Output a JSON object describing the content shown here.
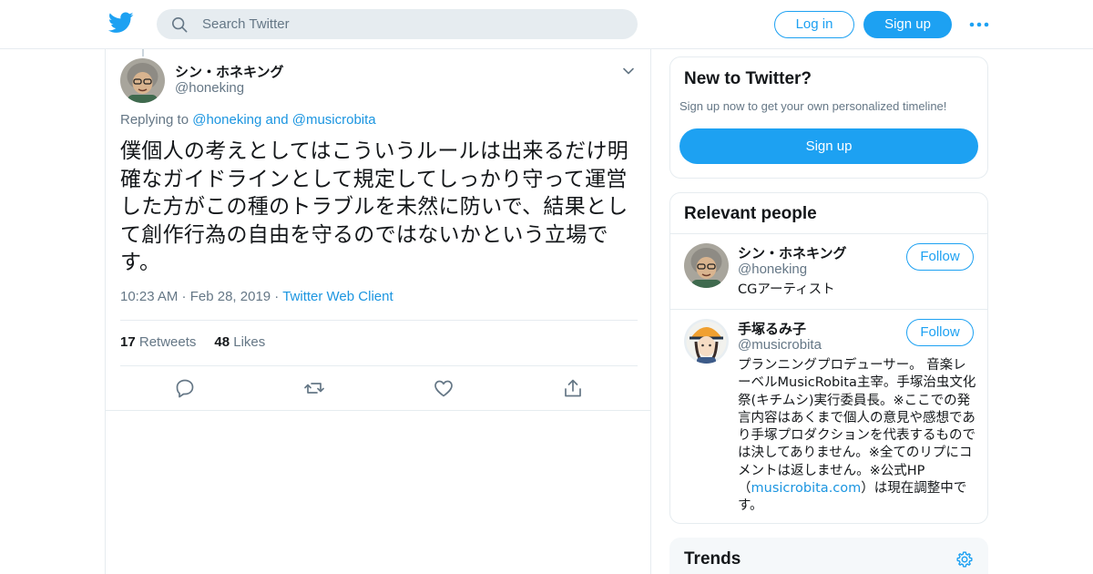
{
  "nav": {
    "search_placeholder": "Search Twitter",
    "login_label": "Log in",
    "signup_label": "Sign up",
    "logo_icon": "twitter-bird-icon",
    "more_icon": "more-dots-icon"
  },
  "tweet": {
    "author_name": "シン・ホネキング",
    "author_handle": "@honeking",
    "replying_prefix": "Replying to ",
    "replying_to_1": "@honeking",
    "replying_and": " and ",
    "replying_to_2": "@musicrobita",
    "text": "僕個人の考えとしてはこういうルールは出来るだけ明確なガイドラインとして規定してしっかり守って運営した方がこの種のトラブルを未然に防いで、結果として創作行為の自由を守るのではないかという立場です。",
    "time": "10:23 AM",
    "date": "Feb 28, 2019",
    "source": "Twitter Web Client",
    "retweets_count": "17",
    "retweets_label": "Retweets",
    "likes_count": "48",
    "likes_label": "Likes"
  },
  "sidebar": {
    "new_title": "New to Twitter?",
    "new_sub": "Sign up now to get your own personalized timeline!",
    "new_signup": "Sign up",
    "people_title": "Relevant people",
    "people": [
      {
        "name": "シン・ホネキング",
        "handle": "@honeking",
        "bio": "CGアーティスト",
        "follow": "Follow"
      },
      {
        "name": "手塚るみ子",
        "handle": "@musicrobita",
        "bio": "プランニングプロデューサー。 音楽レーベルMusicRobita主宰。手塚治虫文化祭(キチムシ)実行委員長。※ここでの発言内容はあくまで個人の意見や感想であり手塚プロダクションを代表するものでは決してありません。※全てのリプにコメントは返しません。※公式HP（",
        "bio_link": "musicrobita.com",
        "bio_tail": "）は現在調整中です。",
        "follow": "Follow"
      }
    ],
    "trends_title": "Trends"
  },
  "colors": {
    "accent": "#1da1f2",
    "link": "#1b95e0",
    "muted": "#657786",
    "border": "#e6ecf0"
  }
}
